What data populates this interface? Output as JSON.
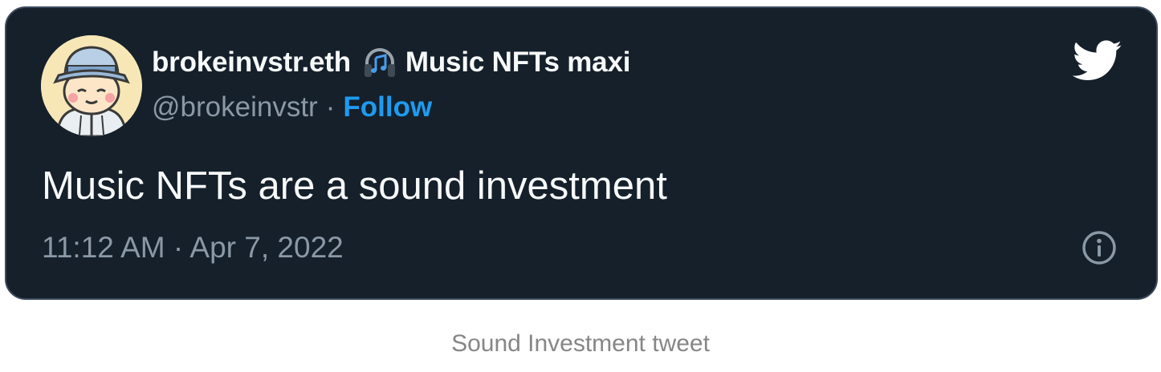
{
  "tweet": {
    "author": {
      "display_name": "brokeinvstr.eth",
      "display_name_suffix": "Music NFTs maxi",
      "handle": "@brokeinvstr",
      "separator": "·",
      "follow_label": "Follow",
      "avatar_icon": "avatar-bucket-hat-character",
      "name_emoji_icon": "headphones-icon"
    },
    "text": "Music NFTs are a sound investment",
    "timestamp": "11:12 AM · Apr 7, 2022",
    "brand_icon": "twitter-bird-icon",
    "info_icon": "info-icon"
  },
  "caption": "Sound Investment tweet",
  "colors": {
    "card_background": "#15202b",
    "card_border": "#3d4a5c",
    "primary_text": "#f7f9f9",
    "secondary_text": "#8b98a5",
    "accent": "#1d9bf0",
    "caption_text": "#868686"
  }
}
